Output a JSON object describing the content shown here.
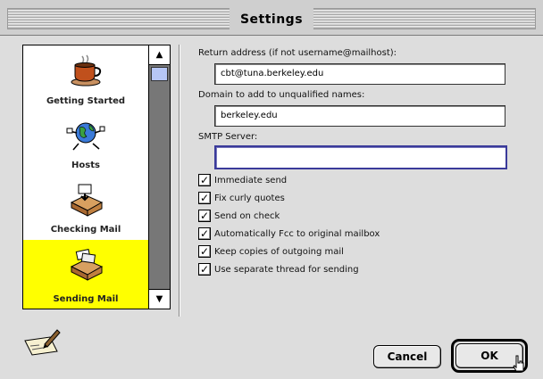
{
  "window": {
    "title": "Settings"
  },
  "sidebar": {
    "items": [
      {
        "label": "Getting Started",
        "icon": "coffee-cup-icon"
      },
      {
        "label": "Hosts",
        "icon": "globe-network-icon"
      },
      {
        "label": "Checking Mail",
        "icon": "mailbox-inbox-icon"
      },
      {
        "label": "Sending Mail",
        "icon": "outbox-letters-icon",
        "selected": true
      }
    ]
  },
  "form": {
    "return_address_label": "Return address (if not username@mailhost):",
    "return_address_value": "cbt@tuna.berkeley.edu",
    "domain_label": "Domain to add to unqualified names:",
    "domain_value": "berkeley.edu",
    "smtp_label": "SMTP Server:",
    "smtp_value": ""
  },
  "options": [
    {
      "label": "Immediate send",
      "checked": true
    },
    {
      "label": "Fix curly quotes",
      "checked": true
    },
    {
      "label": "Send on check",
      "checked": true
    },
    {
      "label": "Automatically Fcc to original mailbox",
      "checked": true
    },
    {
      "label": "Keep copies of outgoing mail",
      "checked": true
    },
    {
      "label": "Use separate thread for sending",
      "checked": true
    }
  ],
  "buttons": {
    "cancel": "Cancel",
    "ok": "OK"
  },
  "colors": {
    "selection": "#ffff00",
    "scroll_thumb": "#b6c6f5",
    "field_focus": "#3a3a9a"
  }
}
